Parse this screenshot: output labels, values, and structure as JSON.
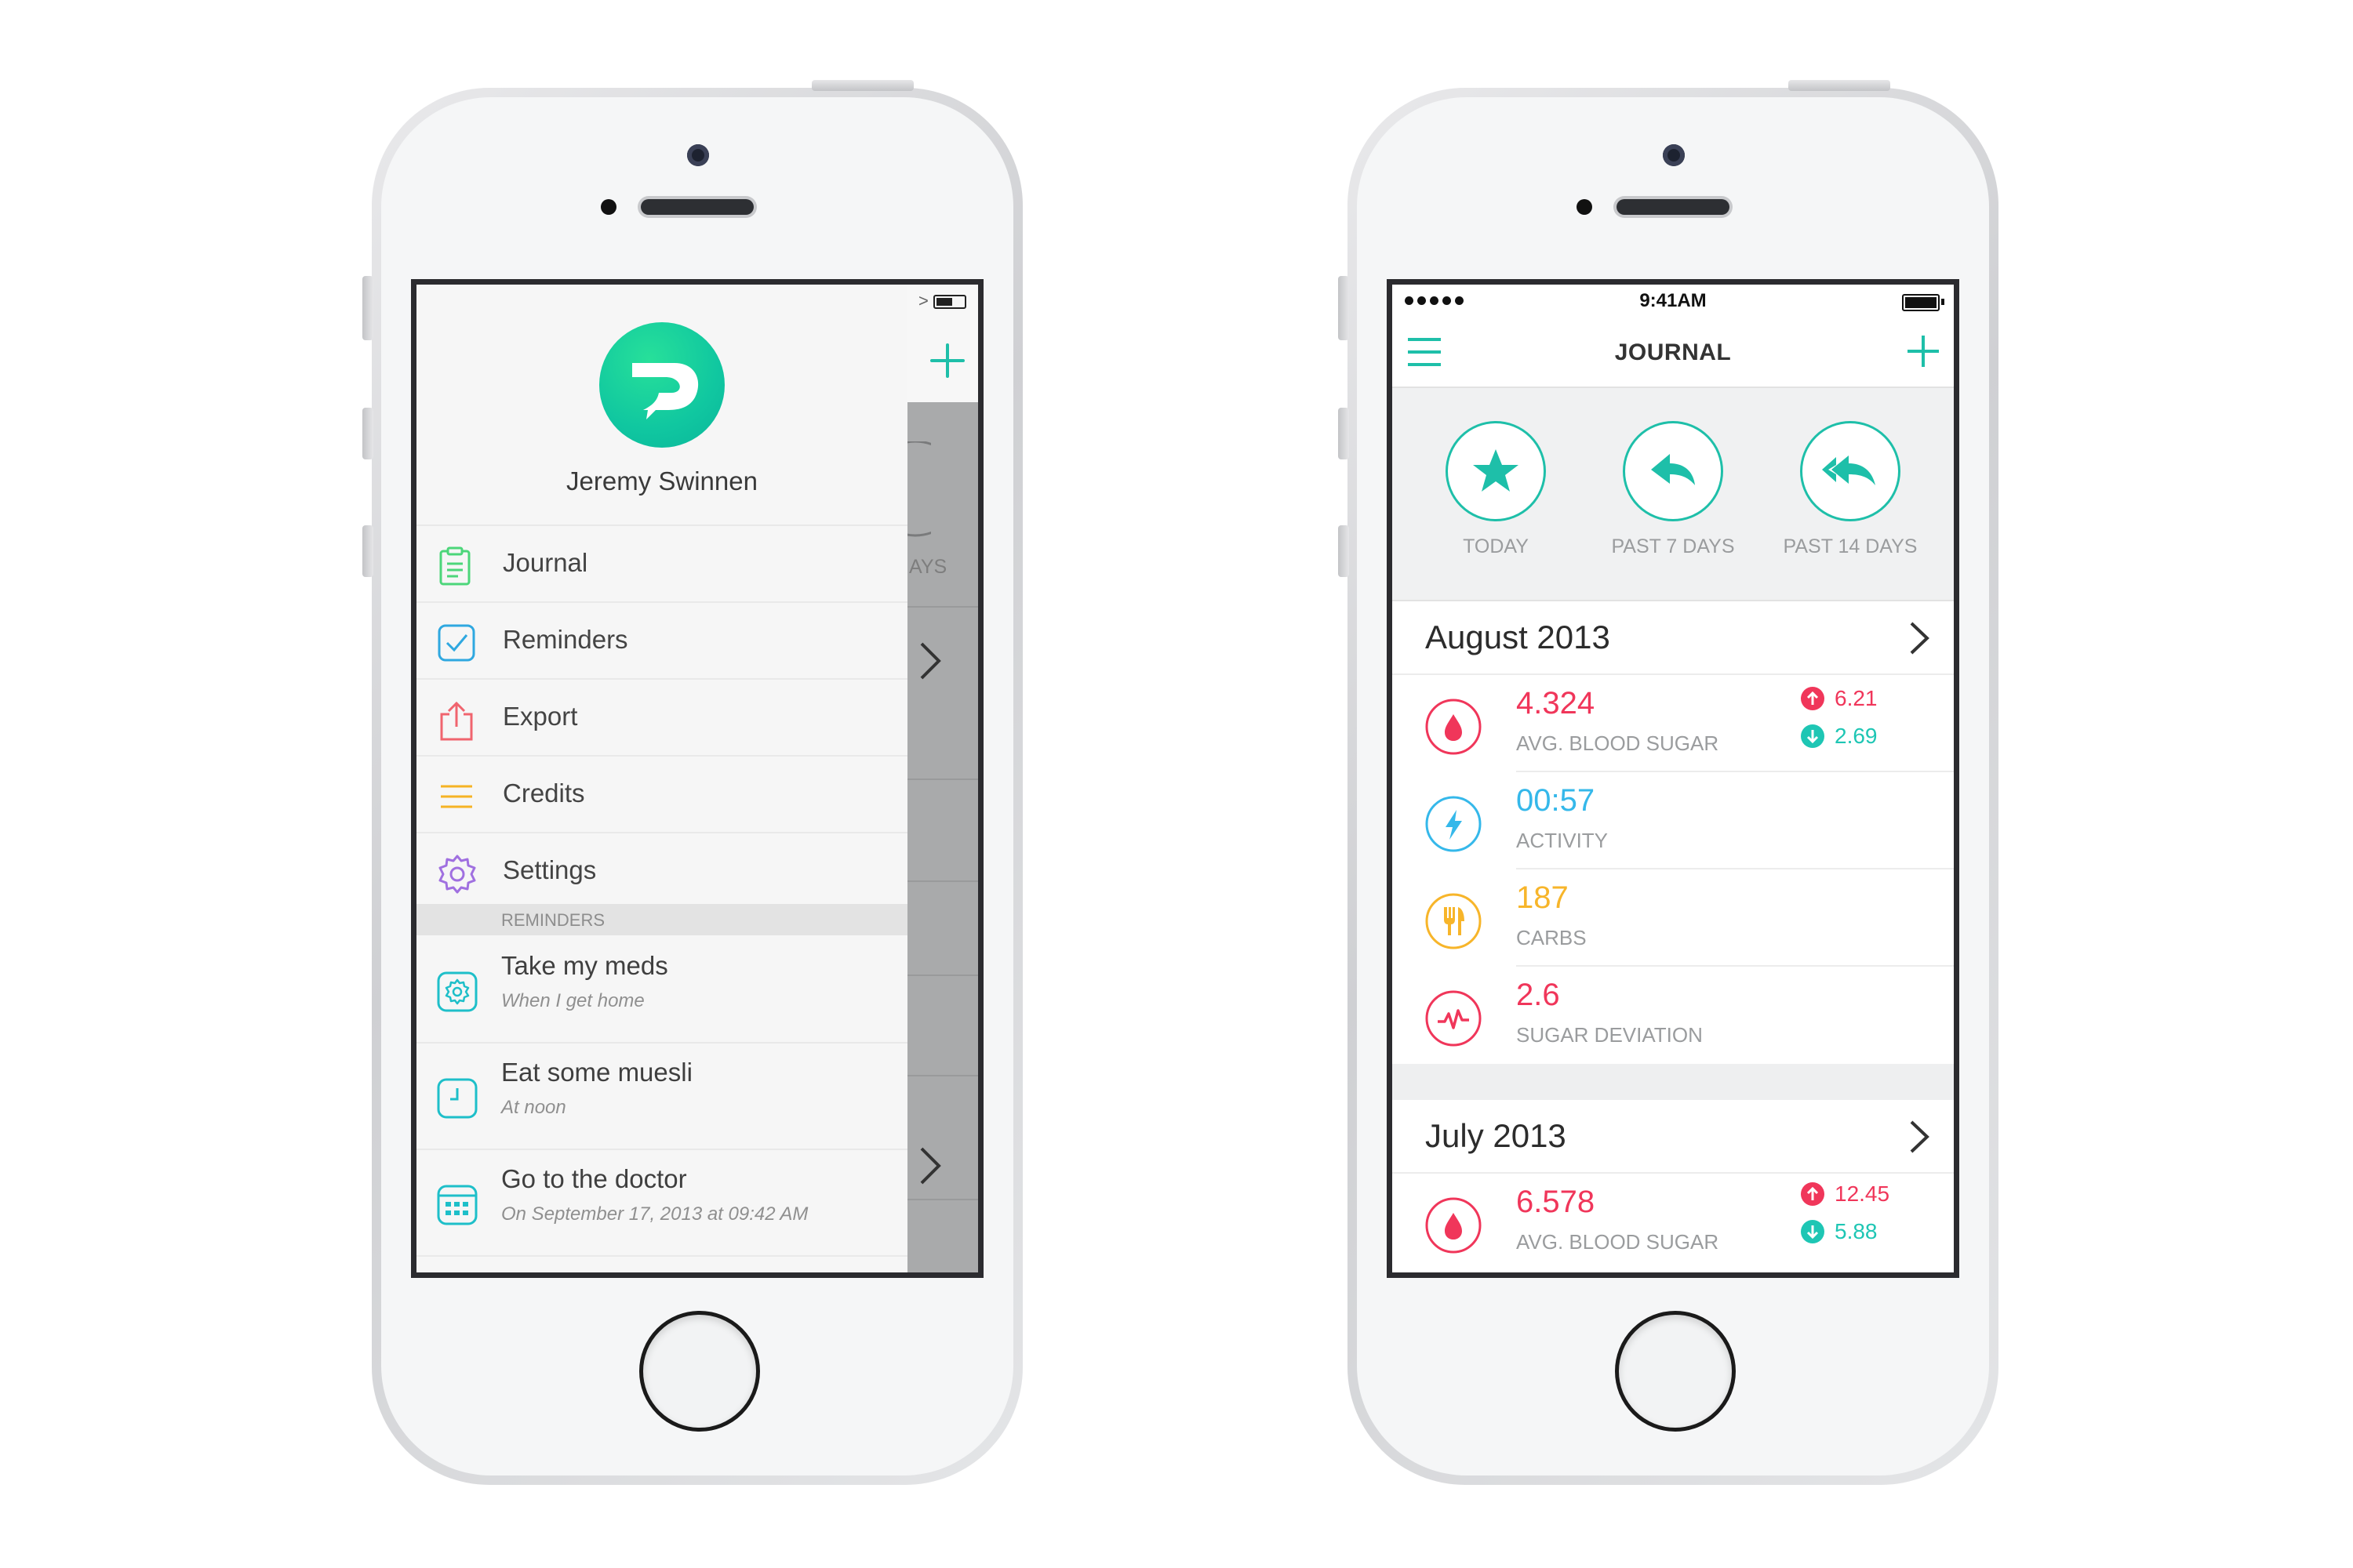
{
  "left_phone": {
    "profile": {
      "name": "Jeremy Swinnen"
    },
    "menu": [
      {
        "label": "Journal",
        "icon": "clipboard-icon",
        "color": "#4cd67a"
      },
      {
        "label": "Reminders",
        "icon": "checkbox-icon",
        "color": "#2fa8e0"
      },
      {
        "label": "Export",
        "icon": "share-icon",
        "color": "#f0646e"
      },
      {
        "label": "Credits",
        "icon": "list-lines-icon",
        "color": "#f5b324"
      },
      {
        "label": "Settings",
        "icon": "gear-icon",
        "color": "#a070e0"
      }
    ],
    "reminders_header": "REMINDERS",
    "reminders": [
      {
        "title": "Take my meds",
        "subtitle": "When I get home",
        "icon": "gear-icon"
      },
      {
        "title": "Eat some muesli",
        "subtitle": "At noon",
        "icon": "clock-icon"
      },
      {
        "title": "Go to the doctor",
        "subtitle": "On September 17, 2013 at 09:42 AM",
        "icon": "calendar-icon"
      }
    ],
    "behind_text": "AYS"
  },
  "right_phone": {
    "status_bar": {
      "time": "9:41AM"
    },
    "nav": {
      "title": "JOURNAL",
      "menu_icon": "hamburger-icon",
      "add_icon": "plus-icon"
    },
    "filters": [
      {
        "label": "TODAY",
        "icon": "star-icon"
      },
      {
        "label": "PAST 7 DAYS",
        "icon": "reply-icon"
      },
      {
        "label": "PAST 14 DAYS",
        "icon": "reply-all-icon"
      }
    ],
    "months": [
      {
        "title": "August 2013",
        "stats": [
          {
            "value": "4.324",
            "label": "AVG. BLOOD SUGAR",
            "icon": "drop-icon",
            "color": "#f0365a",
            "up": "6.21",
            "down": "2.69"
          },
          {
            "value": "00:57",
            "label": "ACTIVITY",
            "icon": "bolt-icon",
            "color": "#35b8ea"
          },
          {
            "value": "187",
            "label": "CARBS",
            "icon": "fork-icon",
            "color": "#f7b52a"
          },
          {
            "value": "2.6",
            "label": "SUGAR DEVIATION",
            "icon": "pulse-icon",
            "color": "#f0365a"
          }
        ]
      },
      {
        "title": "July 2013",
        "stats": [
          {
            "value": "6.578",
            "label": "AVG. BLOOD SUGAR",
            "icon": "drop-icon",
            "color": "#f0365a",
            "up": "12.45",
            "down": "5.88"
          }
        ]
      }
    ],
    "colors": {
      "accent": "#1ebfa9",
      "up": "#f0365a",
      "down": "#1ec6b4"
    }
  }
}
